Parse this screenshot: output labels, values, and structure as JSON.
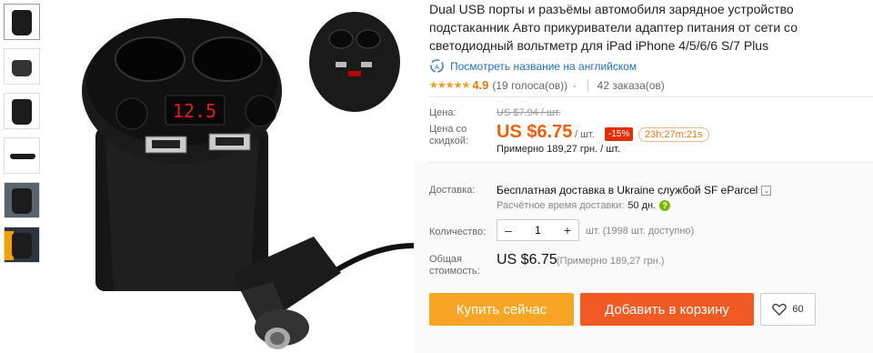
{
  "product": {
    "title": "Dual USB порты и разъёмы автомобиля зарядное устройство подстаканник Авто прикуриватели адаптер питания от сети со светодиодный вольтметр для iPad iPhone 4/5/6/6 S/7 Plus",
    "translate_link": "Посмотреть название на английском",
    "rating_stars": "★★★★★",
    "rating_value": "4.9",
    "votes": "(19 голоса(ов))",
    "orders": "42 заказа(ов)",
    "display_reading": "12.5"
  },
  "pricing": {
    "price_label": "Цена:",
    "old_price": "US $7.94 / шт.",
    "discount_label": "Цена со скидкой:",
    "price": "US $6.75",
    "per_unit": "/ шт.",
    "discount_badge": "-15%",
    "timer": "23h:27m:21s",
    "approx": "Примерно 189,27 грн. / шт."
  },
  "shipping": {
    "label": "Доставка:",
    "text": "Бесплатная доставка в Ukraine службой SF eParcel",
    "time_label": "Расчётное время доставки:",
    "time_value": "50 дн."
  },
  "quantity": {
    "label": "Количество:",
    "value": "1",
    "minus": "–",
    "plus": "+",
    "available": "шт. (1998 шт. доступно)"
  },
  "total": {
    "label": "Общая стоимость:",
    "price": "US $6.75",
    "approx": "(Примерно 189,27 грн.)"
  },
  "actions": {
    "buy_now": "Купить сейчас",
    "add_to_cart": "Добавить в корзину",
    "wishlist_count": "60"
  },
  "colors": {
    "accent_orange": "#f0600c",
    "buy_button": "#f8a424",
    "cart_button": "#f15a22",
    "link_blue": "#1e6fc3"
  }
}
